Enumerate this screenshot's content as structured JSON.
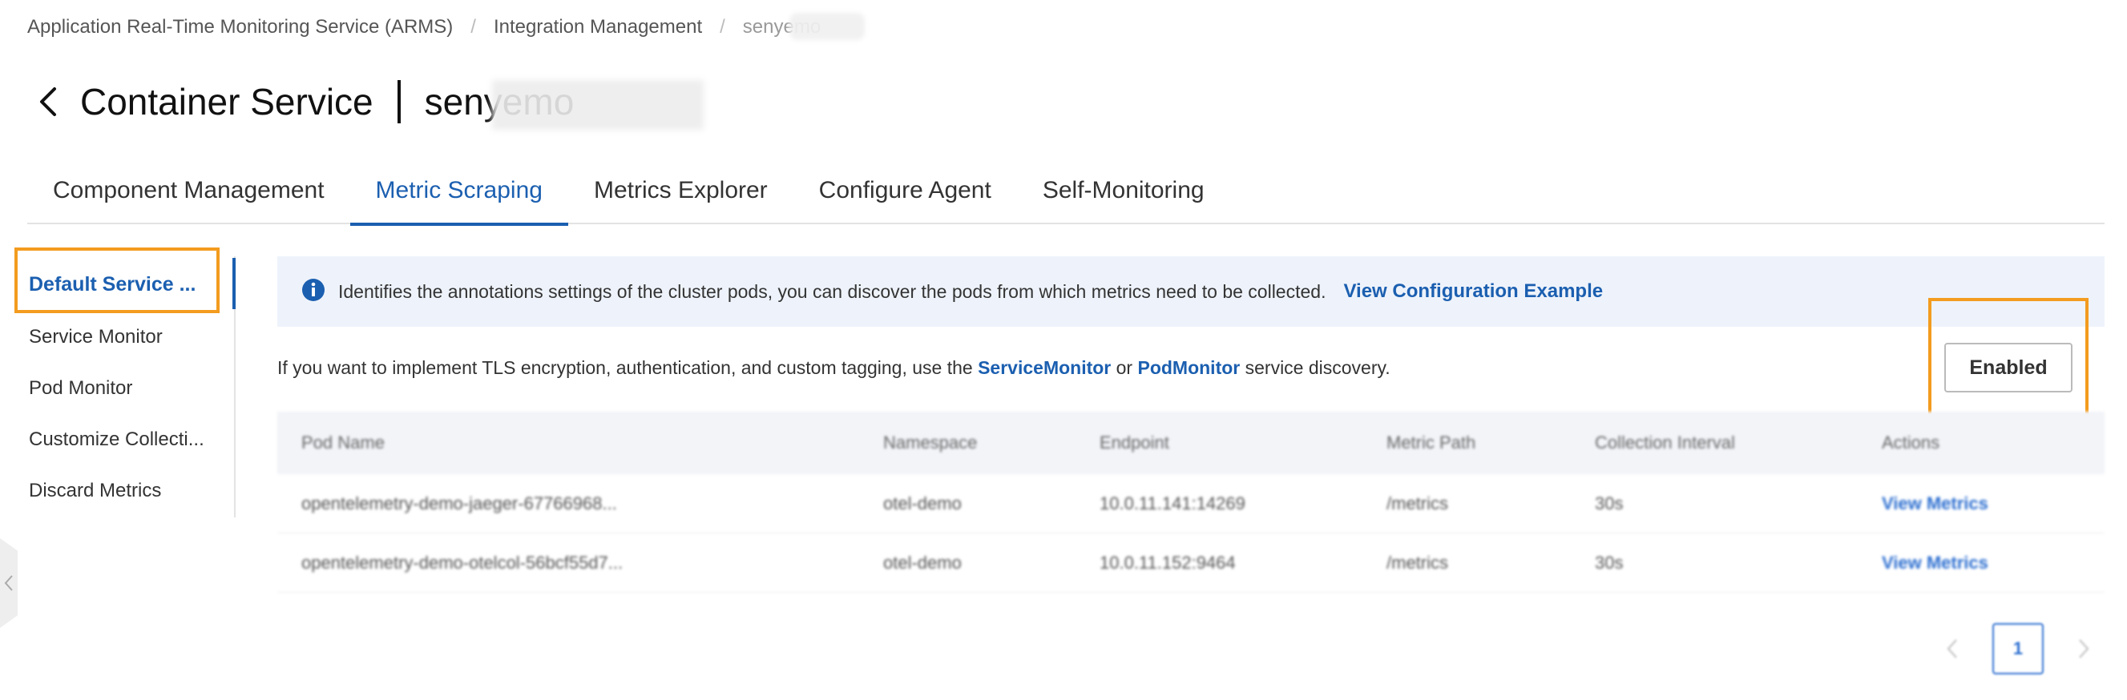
{
  "breadcrumb": {
    "items": [
      "Application Real-Time Monitoring Service (ARMS)",
      "Integration Management",
      "senyemo"
    ],
    "separator": "/"
  },
  "header": {
    "title": "Container Service",
    "subtitle": "senyemo"
  },
  "tabs": [
    {
      "label": "Component Management",
      "active": false
    },
    {
      "label": "Metric Scraping",
      "active": true
    },
    {
      "label": "Metrics Explorer",
      "active": false
    },
    {
      "label": "Configure Agent",
      "active": false
    },
    {
      "label": "Self-Monitoring",
      "active": false
    }
  ],
  "sidebar": {
    "items": [
      {
        "label": "Default Service ...",
        "active": true
      },
      {
        "label": "Service Monitor",
        "active": false
      },
      {
        "label": "Pod Monitor",
        "active": false
      },
      {
        "label": "Customize Collecti...",
        "active": false
      },
      {
        "label": "Discard Metrics",
        "active": false
      }
    ]
  },
  "info_banner": {
    "icon": "info-icon",
    "text": "Identifies the annotations settings of the cluster pods, you can discover the pods from which metrics need to be collected.",
    "link": "View Configuration Example"
  },
  "tls_notice": {
    "prefix": "If you want to implement TLS encryption, authentication, and custom tagging, use the ",
    "link1": "ServiceMonitor",
    "middle": " or ",
    "link2": "PodMonitor",
    "suffix": " service discovery."
  },
  "status_button": {
    "label": "Enabled"
  },
  "table": {
    "columns": [
      "Pod Name",
      "Namespace",
      "Endpoint",
      "Metric Path",
      "Collection Interval",
      "Actions"
    ],
    "rows": [
      {
        "pod": "opentelemetry-demo-jaeger-67766968...",
        "namespace": "otel-demo",
        "endpoint": "10.0.11.141:14269",
        "path": "/metrics",
        "interval": "30s",
        "action": "View Metrics"
      },
      {
        "pod": "opentelemetry-demo-otelcol-56bcf55d7...",
        "namespace": "otel-demo",
        "endpoint": "10.0.11.152:9464",
        "path": "/metrics",
        "interval": "30s",
        "action": "View Metrics"
      }
    ]
  },
  "pagination": {
    "current_page": "1"
  },
  "colors": {
    "accent": "#1b5fb0",
    "highlight": "#f39c1f",
    "banner_bg": "#eef3fb"
  }
}
